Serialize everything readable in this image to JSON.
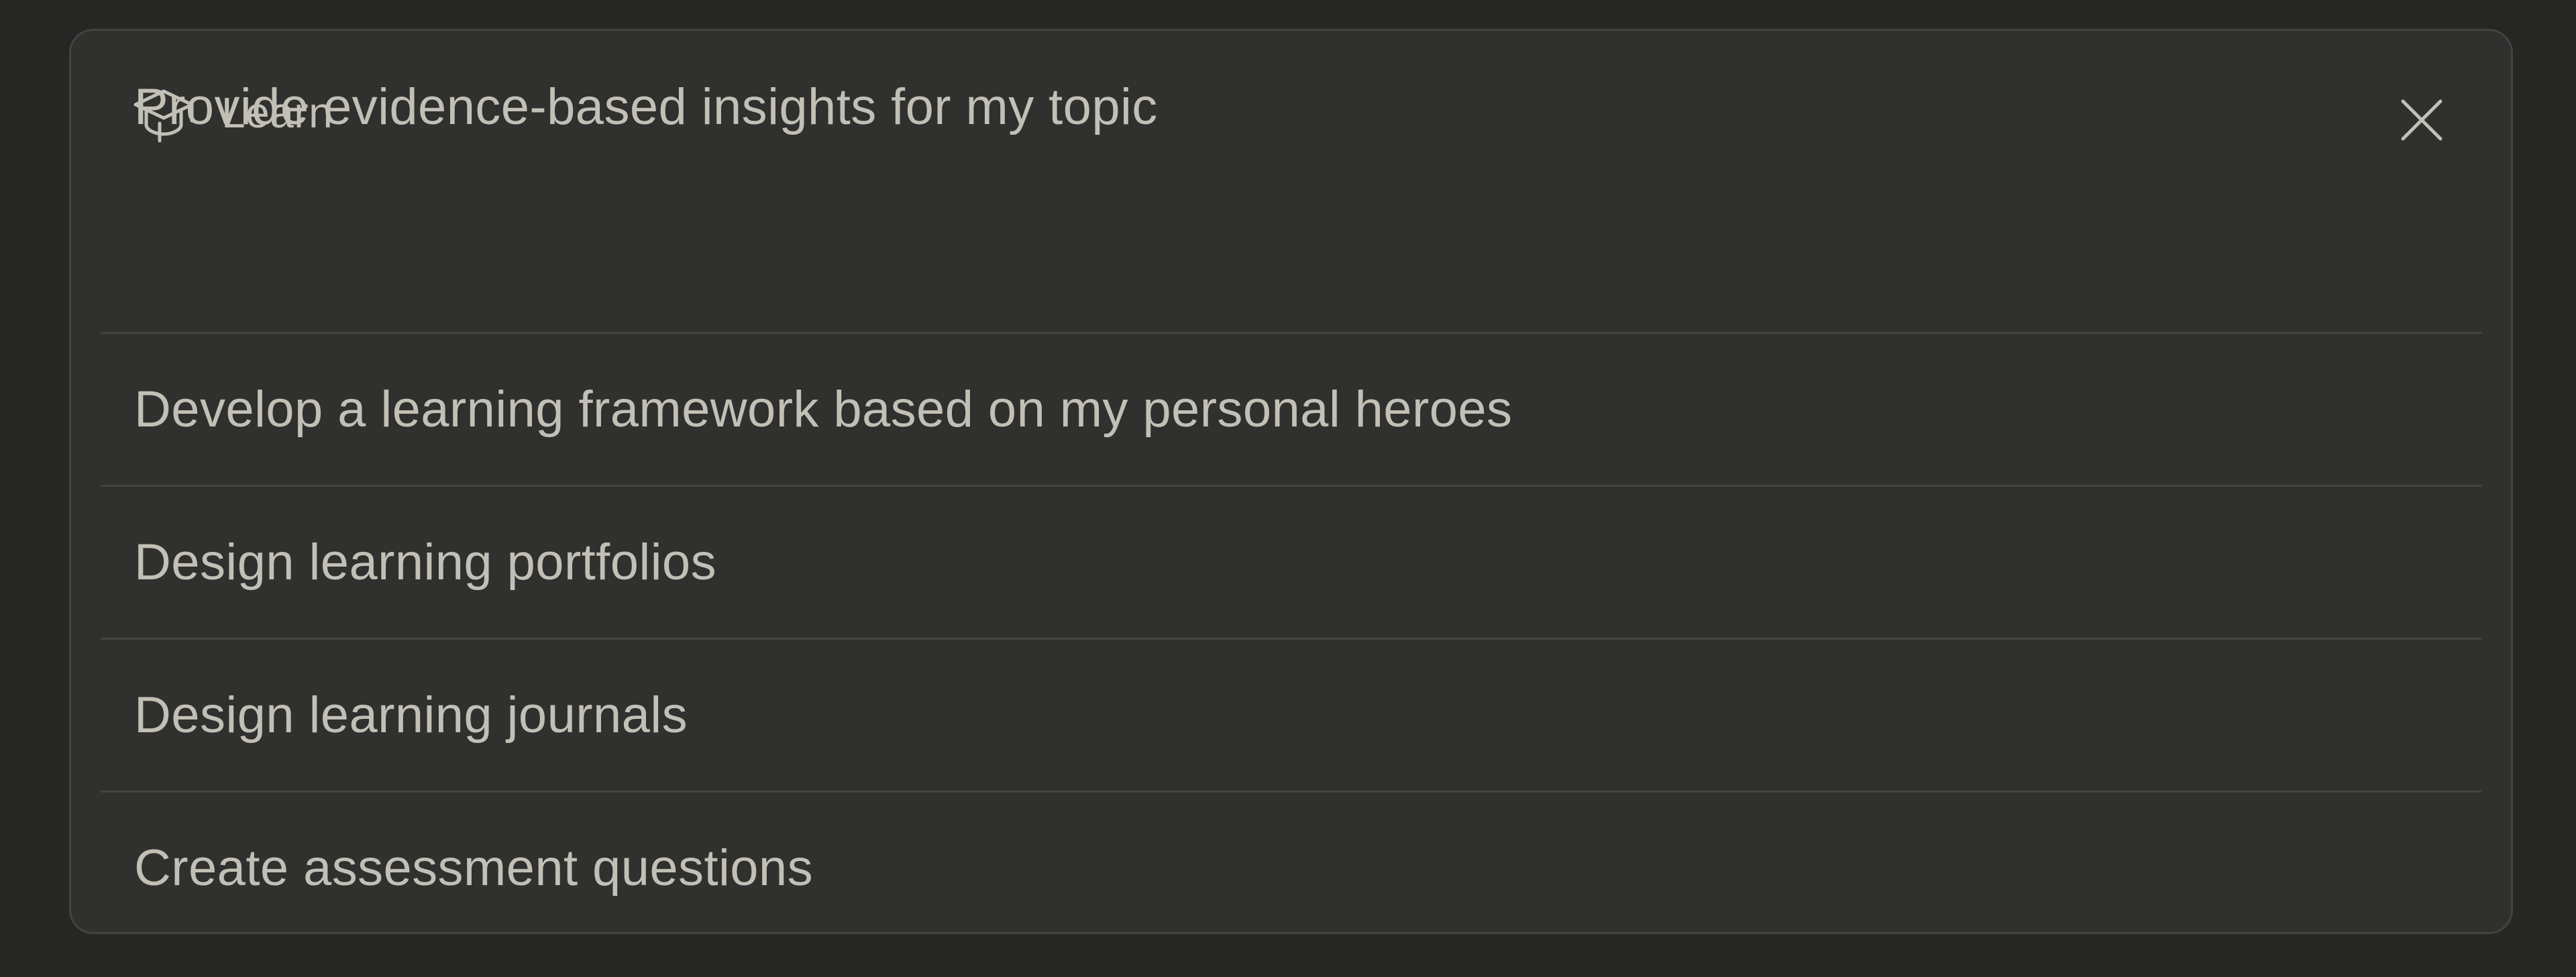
{
  "panel": {
    "title": "Learn",
    "title_icon": "graduation-cap-icon",
    "close_icon": "close-icon"
  },
  "suggestions": [
    {
      "label": "Provide evidence-based insights for my topic"
    },
    {
      "label": "Develop a learning framework based on my personal heroes"
    },
    {
      "label": "Design learning portfolios"
    },
    {
      "label": "Design learning journals"
    },
    {
      "label": "Create assessment questions"
    }
  ],
  "colors": {
    "background": "#262625",
    "panel": "#30302e",
    "border": "#434341",
    "text": "#c2c0b6",
    "divider": "#444442"
  }
}
